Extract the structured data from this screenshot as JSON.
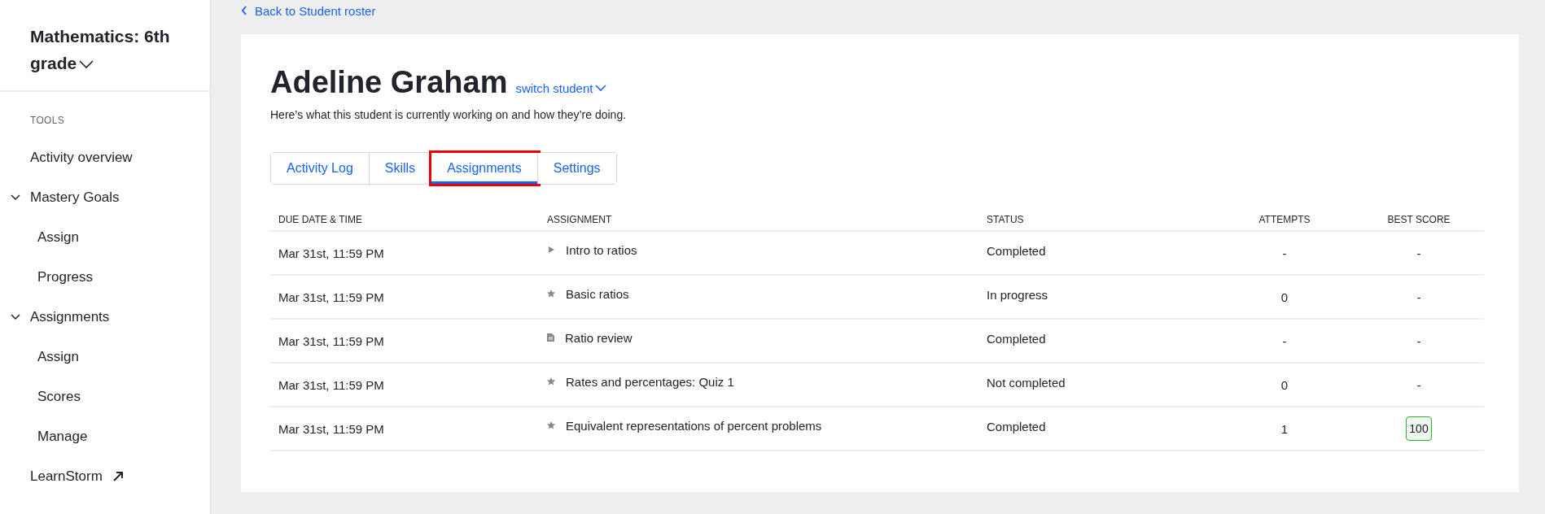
{
  "sidebar": {
    "course": "Mathematics: 6th grade",
    "section": "TOOLS",
    "items": [
      {
        "label": "Activity overview"
      },
      {
        "label": "Mastery Goals",
        "expanded": true,
        "children": [
          {
            "label": "Assign"
          },
          {
            "label": "Progress"
          }
        ]
      },
      {
        "label": "Assignments",
        "expanded": true,
        "children": [
          {
            "label": "Assign"
          },
          {
            "label": "Scores"
          },
          {
            "label": "Manage"
          }
        ]
      },
      {
        "label": "LearnStorm",
        "external": true
      }
    ]
  },
  "back_link": "Back to Student roster",
  "student": {
    "name": "Adeline Graham",
    "switch": "switch student",
    "description": "Here’s what this student is currently working on and how they’re doing."
  },
  "tabs": [
    {
      "label": "Activity Log",
      "selected": false,
      "highlighted": false
    },
    {
      "label": "Skills",
      "selected": false,
      "highlighted": false
    },
    {
      "label": "Assignments",
      "selected": true,
      "highlighted": true
    },
    {
      "label": "Settings",
      "selected": false,
      "highlighted": false
    }
  ],
  "table": {
    "columns": [
      "DUE DATE & TIME",
      "ASSIGNMENT",
      "STATUS",
      "ATTEMPTS",
      "BEST SCORE"
    ],
    "rows": [
      {
        "due": "Mar 31st, 11:59 PM",
        "kind": "video",
        "assignment": "Intro to ratios",
        "status": "Completed",
        "attempts": "-",
        "best_score": "-",
        "score_badge": false
      },
      {
        "due": "Mar 31st, 11:59 PM",
        "kind": "exercise",
        "assignment": "Basic ratios",
        "status": "In progress",
        "attempts": "0",
        "best_score": "-",
        "score_badge": false
      },
      {
        "due": "Mar 31st, 11:59 PM",
        "kind": "article",
        "assignment": "Ratio review",
        "status": "Completed",
        "attempts": "-",
        "best_score": "-",
        "score_badge": false
      },
      {
        "due": "Mar 31st, 11:59 PM",
        "kind": "exercise",
        "assignment": "Rates and percentages: Quiz 1",
        "status": "Not completed",
        "attempts": "0",
        "best_score": "-",
        "score_badge": false
      },
      {
        "due": "Mar 31st, 11:59 PM",
        "kind": "exercise",
        "assignment": "Equivalent representations of percent problems",
        "status": "Completed",
        "attempts": "1",
        "best_score": "100",
        "score_badge": true
      }
    ]
  }
}
